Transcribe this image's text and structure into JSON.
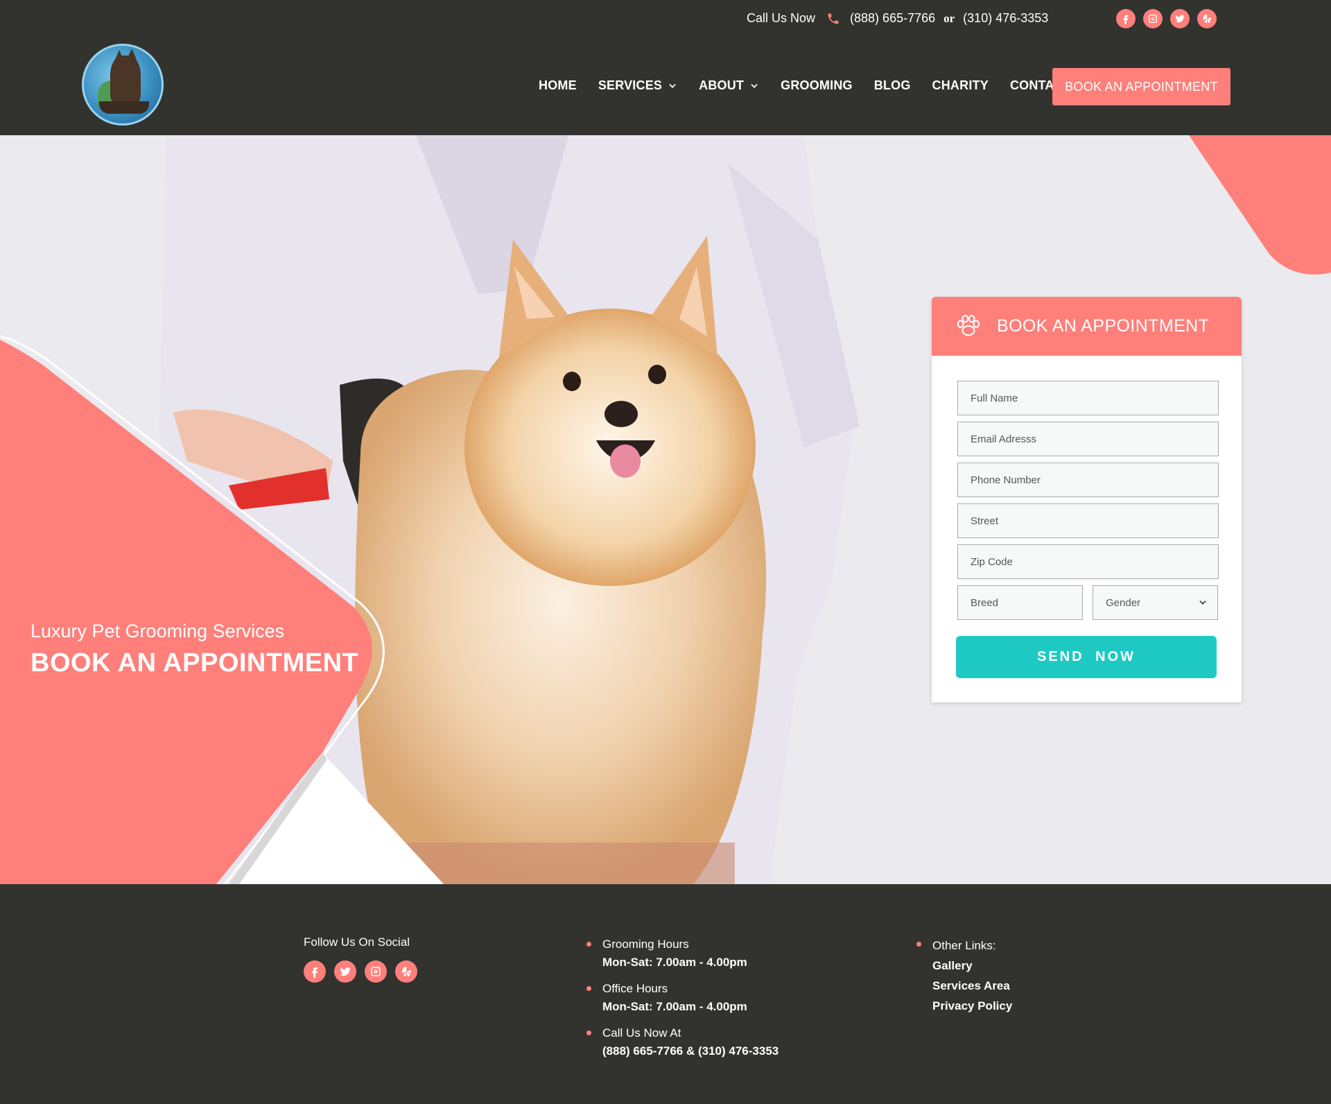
{
  "topbar": {
    "call_label": "Call Us Now",
    "phone_1": "(888) 665-7766",
    "or_label": "or",
    "phone_2": "(310) 476-3353",
    "social_icons": [
      "facebook-icon",
      "instagram-icon",
      "twitter-icon",
      "yelp-icon"
    ]
  },
  "nav": {
    "items": [
      {
        "label": "HOME",
        "has_dropdown": false
      },
      {
        "label": "SERVICES",
        "has_dropdown": true
      },
      {
        "label": "ABOUT",
        "has_dropdown": true
      },
      {
        "label": "GROOMING",
        "has_dropdown": false
      },
      {
        "label": "BLOG",
        "has_dropdown": false
      },
      {
        "label": "CHARITY",
        "has_dropdown": false
      },
      {
        "label": "CONTACT",
        "has_dropdown": false
      }
    ],
    "book_button": "BOOK  AN APPOINTMENT"
  },
  "hero": {
    "subtitle": "Luxury Pet Grooming Services",
    "title": "BOOK AN APPOINTMENT"
  },
  "form": {
    "title": "BOOK AN APPOINTMENT",
    "full_name_placeholder": "Full Name",
    "email_placeholder": "Email Adresss",
    "phone_placeholder": "Phone Number",
    "street_placeholder": "Street",
    "zip_placeholder": "Zip Code",
    "breed_placeholder": "Breed",
    "gender_selected": "Gender",
    "send_button": "SEND  NOW"
  },
  "footer": {
    "social_label": "Follow Us On Social",
    "grooming_hours_label": "Grooming Hours",
    "grooming_hours_value": "Mon-Sat: 7.00am - 4.00pm",
    "office_hours_label": "Office Hours",
    "office_hours_value": "Mon-Sat: 7.00am - 4.00pm",
    "call_label": "Call Us Now At",
    "call_value": "(888) 665-7766  &  (310) 476-3353",
    "other_links_label": "Other Links:",
    "links": [
      "Gallery",
      "Services Area",
      "Privacy Policy"
    ]
  },
  "colors": {
    "accent": "#ff7f7a",
    "send_button": "#1ec9c4",
    "dark_bg": "#32322f"
  }
}
